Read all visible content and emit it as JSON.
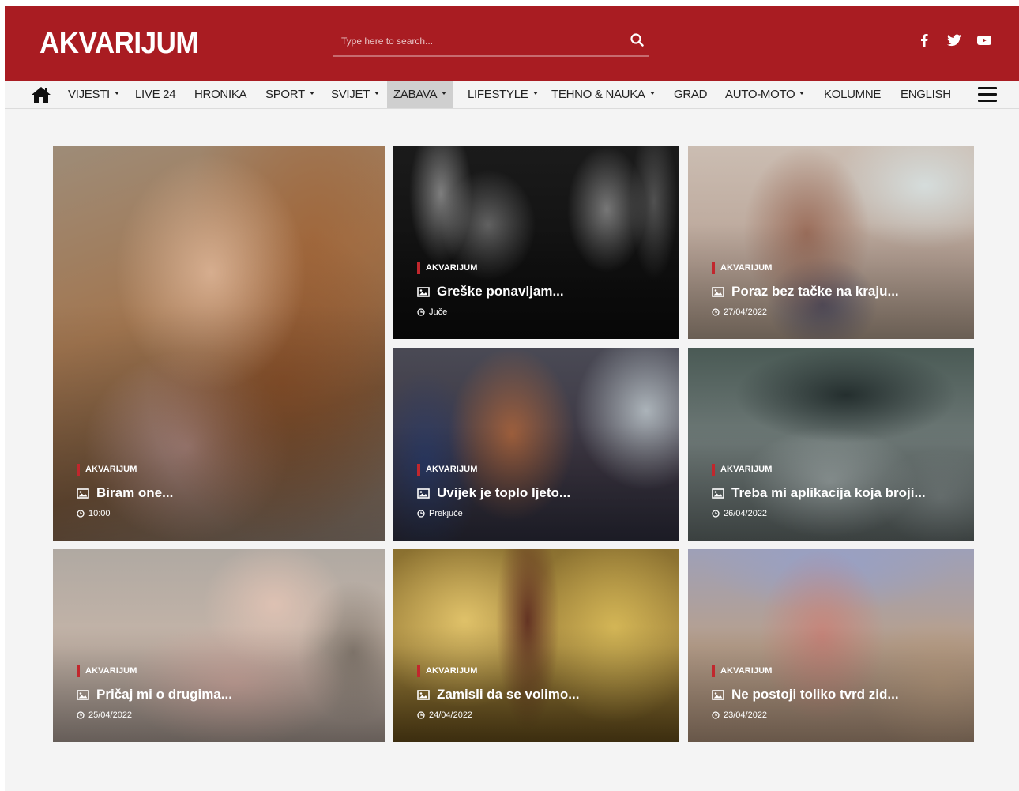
{
  "site": {
    "logo": "AKVARIJUM"
  },
  "search": {
    "placeholder": "Type here to search..."
  },
  "social": [
    "facebook-icon",
    "twitter-icon",
    "youtube-icon"
  ],
  "nav": {
    "items": [
      {
        "label": "VIJESTI",
        "dropdown": true
      },
      {
        "label": "LIVE 24",
        "dropdown": false
      },
      {
        "label": "HRONIKA",
        "dropdown": false
      },
      {
        "label": "SPORT",
        "dropdown": true
      },
      {
        "label": "SVIJET",
        "dropdown": true
      },
      {
        "label": "ZABAVA",
        "dropdown": true,
        "active": true
      },
      {
        "label": "LIFESTYLE",
        "dropdown": true
      },
      {
        "label": "TEHNO & NAUKA",
        "dropdown": true
      },
      {
        "label": "GRAD",
        "dropdown": false
      },
      {
        "label": "AUTO-MOTO",
        "dropdown": true
      },
      {
        "label": "KOLUMNE",
        "dropdown": false
      },
      {
        "label": "ENGLISH",
        "dropdown": false
      }
    ]
  },
  "articles": [
    {
      "category": "AKVARIJUM",
      "title": "Biram one...",
      "date": "10:00"
    },
    {
      "category": "AKVARIJUM",
      "title": "Greške ponavljam...",
      "date": "Juče"
    },
    {
      "category": "AKVARIJUM",
      "title": "Poraz bez tačke na kraju...",
      "date": "27/04/2022"
    },
    {
      "category": "AKVARIJUM",
      "title": "Uvijek je toplo ljeto...",
      "date": "Prekjuče"
    },
    {
      "category": "AKVARIJUM",
      "title": "Treba mi aplikacija koja broji...",
      "date": "26/04/2022"
    },
    {
      "category": "AKVARIJUM",
      "title": "Pričaj mi o drugima...",
      "date": "25/04/2022"
    },
    {
      "category": "AKVARIJUM",
      "title": "Zamisli da se volimo...",
      "date": "24/04/2022"
    },
    {
      "category": "AKVARIJUM",
      "title": "Ne postoji toliko tvrd zid...",
      "date": "23/04/2022"
    }
  ],
  "colors": {
    "brand": "#a91c22",
    "accent": "#c1272d",
    "page_bg": "#f4f4f4",
    "nav_active_bg": "#cfcfcf"
  }
}
